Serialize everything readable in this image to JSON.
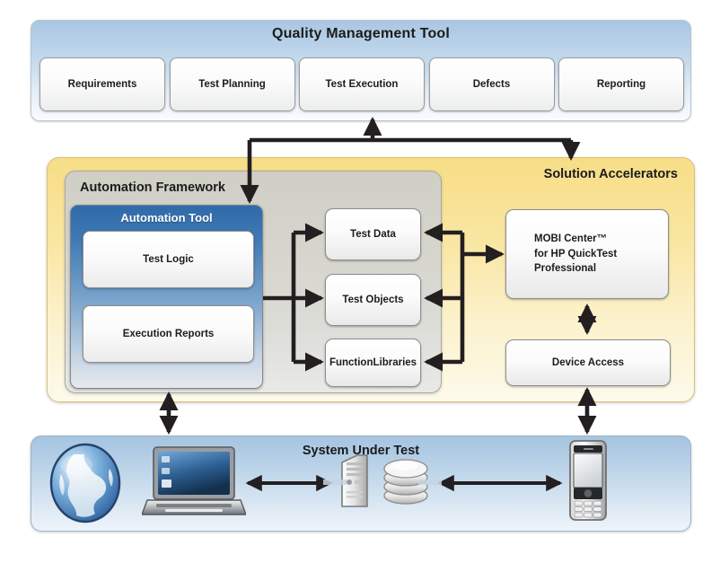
{
  "quality_management": {
    "title": "Quality Management Tool",
    "items": [
      {
        "label": "Requirements"
      },
      {
        "label": "Test Planning"
      },
      {
        "label": "Test Execution"
      },
      {
        "label": "Defects"
      },
      {
        "label": "Reporting"
      }
    ]
  },
  "solution_accelerators": {
    "title": "Solution Accelerators",
    "boxes": [
      {
        "label": "MOBI Center™\nfor HP QuickTest\nProfessional",
        "line1": "MOBI Center™",
        "line2": "for HP QuickTest",
        "line3": "Professional"
      },
      {
        "label": "Device Access"
      }
    ]
  },
  "automation_framework": {
    "title": "Automation Framework",
    "automation_tool": {
      "title": "Automation Tool",
      "items": [
        {
          "label": "Test Logic"
        },
        {
          "label": "Execution Reports"
        }
      ]
    },
    "assets": [
      {
        "label": "Test Data"
      },
      {
        "label": "Test Objects"
      },
      {
        "line1": "Function",
        "line2": "Libraries"
      }
    ]
  },
  "system_under_test": {
    "title": "System Under Test",
    "nodes": [
      {
        "icon": "globe-icon",
        "label": ""
      },
      {
        "icon": "laptop-icon",
        "label": ""
      },
      {
        "icon": "server-icon",
        "label": ""
      },
      {
        "icon": "database-icon",
        "label": ""
      },
      {
        "icon": "mobile-phone-icon",
        "label": ""
      }
    ]
  },
  "colors": {
    "qm_panel": "#bcd4e9",
    "accelerator_yellow": "#f7dd86",
    "framework_grey": "#d6d6cd",
    "automation_tool_blue": "#3f79b4",
    "sut_blue": "#bcd4e9",
    "arrow": "#231f20"
  }
}
